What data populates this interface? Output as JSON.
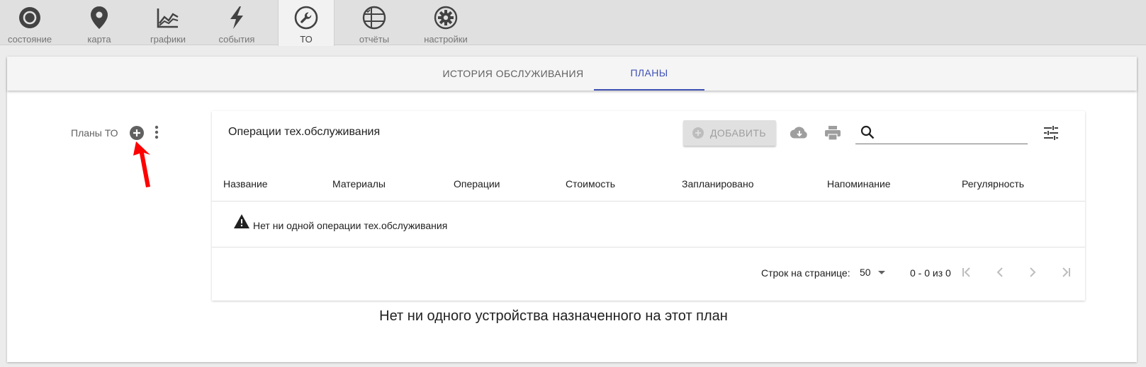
{
  "topnav": {
    "tabs": [
      {
        "label": "состояние",
        "icon": "status-circle-icon"
      },
      {
        "label": "карта",
        "icon": "map-pin-icon"
      },
      {
        "label": "графики",
        "icon": "chart-icon"
      },
      {
        "label": "события",
        "icon": "lightning-icon"
      },
      {
        "label": "ТО",
        "icon": "wrench-icon",
        "active": true
      },
      {
        "label": "отчёты",
        "icon": "report-icon"
      },
      {
        "label": "настройки",
        "icon": "gear-icon"
      }
    ]
  },
  "subtabs": {
    "history": "ИСТОРИЯ ОБСЛУЖИВАНИЯ",
    "plans": "ПЛАНЫ"
  },
  "plans_label": "Планы ТО",
  "panel": {
    "title": "Операции тех.обслуживания",
    "add_button": "ДОБАВИТЬ",
    "search_placeholder": "",
    "columns": [
      "Название",
      "Материалы",
      "Операции",
      "Стоимость",
      "Запланировано",
      "Напоминание",
      "Регулярность"
    ],
    "empty_text": "Нет ни одной операции тех.обслуживания",
    "pager": {
      "rows_label": "Строк на странице:",
      "rows_value": "50",
      "range": "0 - 0 из 0"
    }
  },
  "bottom_message": "Нет ни одного устройства назначенного на этот план",
  "colors": {
    "accent": "#3f51b5",
    "annotation_arrow": "#ff0000"
  }
}
